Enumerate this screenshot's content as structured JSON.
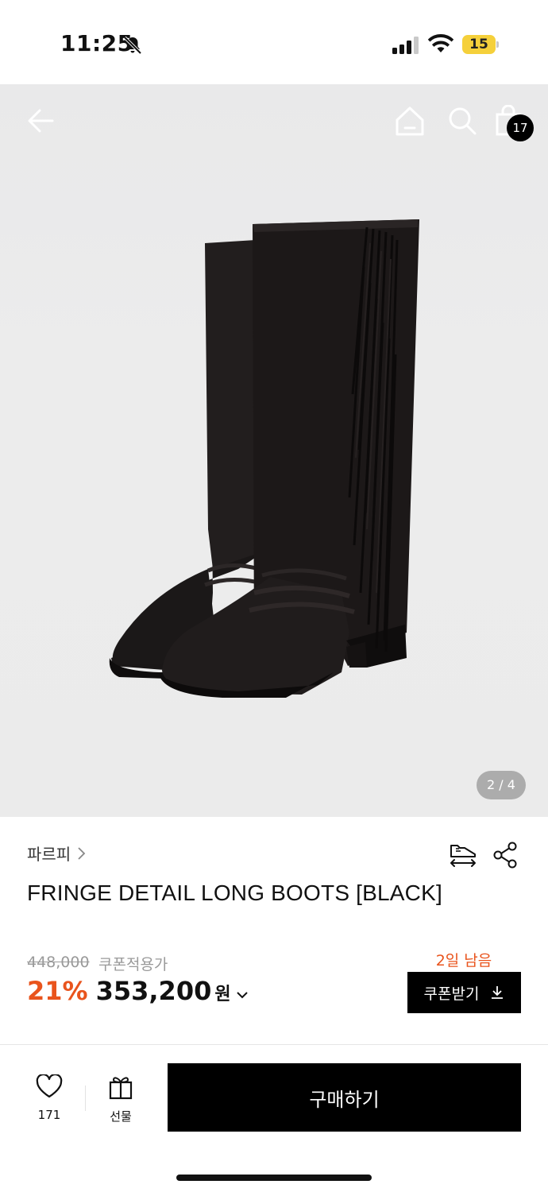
{
  "status_bar": {
    "time": "11:25",
    "battery_level": "15",
    "battery_color": "#f5d03b"
  },
  "hero": {
    "page_indicator": "2 / 4",
    "cart_count": "17",
    "icons": [
      "arrow-left-icon",
      "home-icon",
      "search-icon",
      "shopping-bag-icon"
    ]
  },
  "product": {
    "brand": "파르피",
    "name": "FRINGE DETAIL LONG BOOTS [BLACK]",
    "original_price": "448,000",
    "coupon_applied_label": "쿠폰적용가",
    "discount": "21%",
    "price": "353,200",
    "currency": "원",
    "days_left": "2일 남음",
    "coupon_button_label": "쿠폰받기"
  },
  "bottom_bar": {
    "like_count": "171",
    "gift_label": "선물",
    "buy_label": "구매하기"
  },
  "colors": {
    "accent": "#e9541d",
    "primary_button": "#000000"
  }
}
